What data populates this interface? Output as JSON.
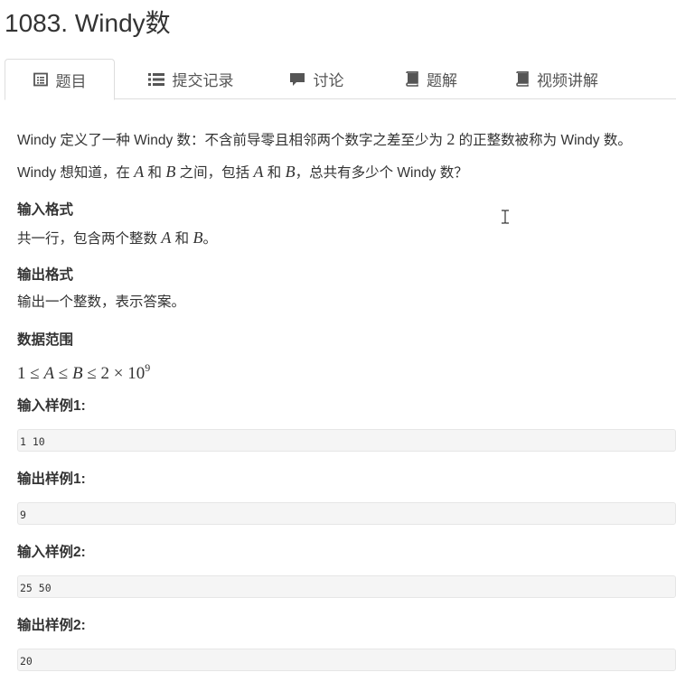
{
  "problem": {
    "title": "1083. Windy数"
  },
  "tabs": [
    {
      "label": "题目",
      "icon": "list-alt-icon",
      "active": true
    },
    {
      "label": "提交记录",
      "icon": "list-icon",
      "active": false
    },
    {
      "label": "讨论",
      "icon": "comment-icon",
      "active": false
    },
    {
      "label": "题解",
      "icon": "book-icon",
      "active": false
    },
    {
      "label": "视频讲解",
      "icon": "book-icon",
      "active": false
    }
  ],
  "description": {
    "line1": {
      "a": "Windy 定义了一种 Windy 数：不含前导零且相邻两个数字之差至少为 ",
      "num": "2",
      "b": " 的正整数被称为 Windy 数。"
    },
    "line2": {
      "a": "Windy 想知道，在 ",
      "A": "A",
      "b": " 和 ",
      "B": "B",
      "c": " 之间，包括 ",
      "A2": "A",
      "d": " 和 ",
      "B2": "B",
      "e": "，总共有多少个 Windy 数？"
    }
  },
  "input_format": {
    "heading": "输入格式",
    "a": "共一行，包含两个整数 ",
    "A": "A",
    "b": " 和 ",
    "B": "B",
    "c": "。"
  },
  "output_format": {
    "heading": "输出格式",
    "text": "输出一个整数，表示答案。"
  },
  "data_range": {
    "heading": "数据范围",
    "one": "1",
    "le1": " ≤ ",
    "A": "A",
    "le2": " ≤ ",
    "B": "B",
    "le3": " ≤ ",
    "two": "2",
    "times": " × ",
    "ten": "10",
    "exp": "9"
  },
  "samples": [
    {
      "heading": "输入样例1:",
      "value": "1 10"
    },
    {
      "heading": "输出样例1:",
      "value": "9"
    },
    {
      "heading": "输入样例2:",
      "value": "25 50"
    },
    {
      "heading": "输出样例2:",
      "value": "20"
    }
  ]
}
